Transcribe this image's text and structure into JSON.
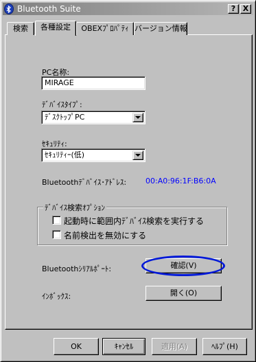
{
  "window": {
    "title": "Bluetooth Suite",
    "help_button": "?",
    "close_button": "X"
  },
  "tabs": [
    {
      "label": "検索",
      "active": false
    },
    {
      "label": "各種設定",
      "active": true
    },
    {
      "label": "OBEXﾌﾟﾛﾊﾟﾃｨ",
      "active": false
    },
    {
      "label": "バージョン情報",
      "active": false
    }
  ],
  "settings": {
    "pc_name_label": "PC名称:",
    "pc_name_value": "MIRAGE",
    "device_type_label": "ﾃﾞﾊﾞｲｽﾀｲﾌﾟ:",
    "device_type_value": "ﾃﾞｽｸﾄｯﾌﾟPC",
    "security_label": "ｾｷｭﾘﾃｨ:",
    "security_value": "ｾｷｭﾘﾃｨｰ(低)",
    "address_label": "Bluetoothﾃﾞﾊﾞｲｽ･ｱﾄﾞﾚｽ:",
    "address_value": "00:A0:96:1F:B6:0A",
    "address_color": "#0000ff"
  },
  "search_options": {
    "title": "ﾃﾞﾊﾞｲｽ検索ｵﾌﾟｼｮﾝ",
    "options": [
      {
        "label": "起動時に範囲内ﾃﾞﾊﾞｲｽ検索を実行する",
        "checked": false
      },
      {
        "label": "名前検出を無効にする",
        "checked": false
      }
    ]
  },
  "serial_port": {
    "label": "Bluetoothｼﾘｱﾙﾎﾟｰﾄ:",
    "button": "確認(V)",
    "highlight_color": "#0018d8"
  },
  "inbox": {
    "label": "ｲﾝﾎﾞｯｸｽ:",
    "button": "開く(O)"
  },
  "footer": {
    "ok": "OK",
    "cancel": "ｷｬﾝｾﾙ",
    "apply": "適用(A)",
    "help": "ﾍﾙﾌﾟ(H)"
  }
}
